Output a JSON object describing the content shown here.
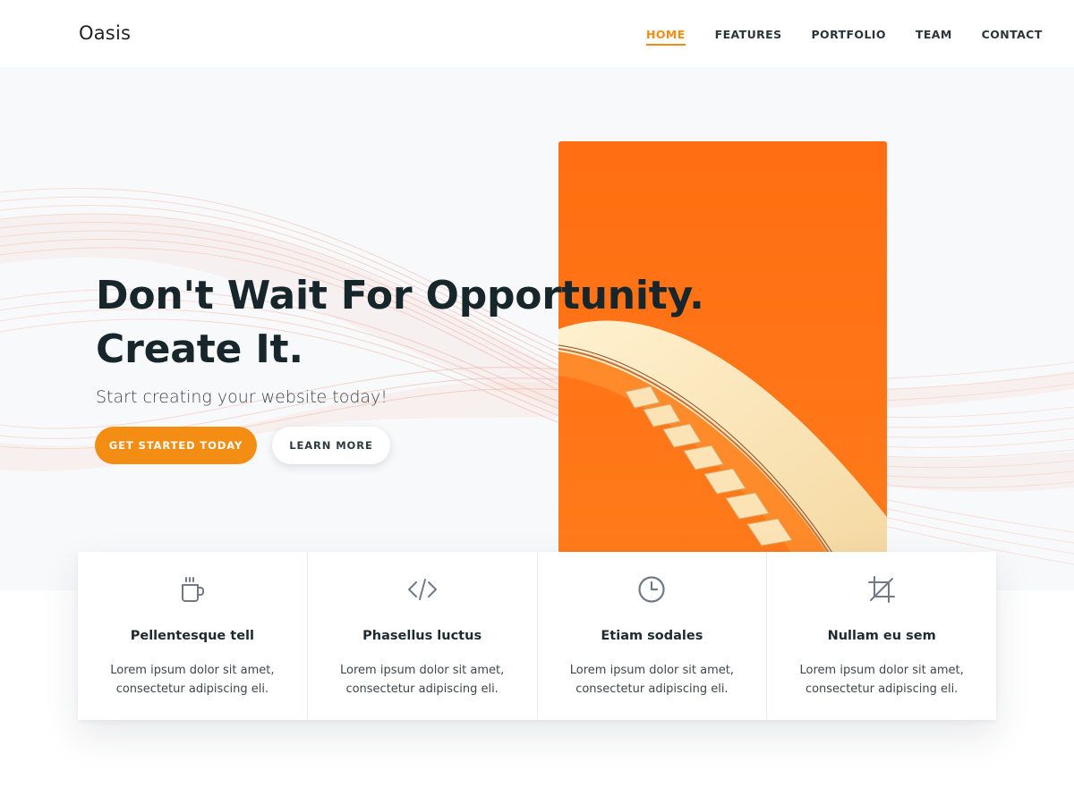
{
  "brand": {
    "name": "Oasis"
  },
  "nav": {
    "items": [
      {
        "label": "HOME",
        "active": true
      },
      {
        "label": "FEATURES",
        "active": false
      },
      {
        "label": "PORTFOLIO",
        "active": false
      },
      {
        "label": "TEAM",
        "active": false
      },
      {
        "label": "CONTACT",
        "active": false
      }
    ]
  },
  "hero": {
    "title_line1": "Don't Wait For Opportunity.",
    "title_line2": "Create It.",
    "subtitle": "Start creating your website today!",
    "primary_button": "GET STARTED TODAY",
    "secondary_button": "LEARN MORE",
    "image_icon": "orange-staircase-photo"
  },
  "features": [
    {
      "icon": "coffee-mug-icon",
      "title": "Pellentesque tell",
      "desc_line1": "Lorem ipsum dolor sit amet,",
      "desc_line2": "consectetur adipiscing eli."
    },
    {
      "icon": "code-icon",
      "title": "Phasellus luctus",
      "desc_line1": "Lorem ipsum dolor sit amet,",
      "desc_line2": "consectetur adipiscing eli."
    },
    {
      "icon": "clock-icon",
      "title": "Etiam sodales",
      "desc_line1": "Lorem ipsum dolor sit amet,",
      "desc_line2": "consectetur adipiscing eli."
    },
    {
      "icon": "crop-icon",
      "title": "Nullam eu sem",
      "desc_line1": "Lorem ipsum dolor sit amet,",
      "desc_line2": "consectetur adipiscing eli."
    }
  ],
  "colors": {
    "accent": "#f48c11",
    "heading": "#17262b",
    "hero_bg": "#f8f9fb",
    "image_orange": "#ff6f14"
  }
}
